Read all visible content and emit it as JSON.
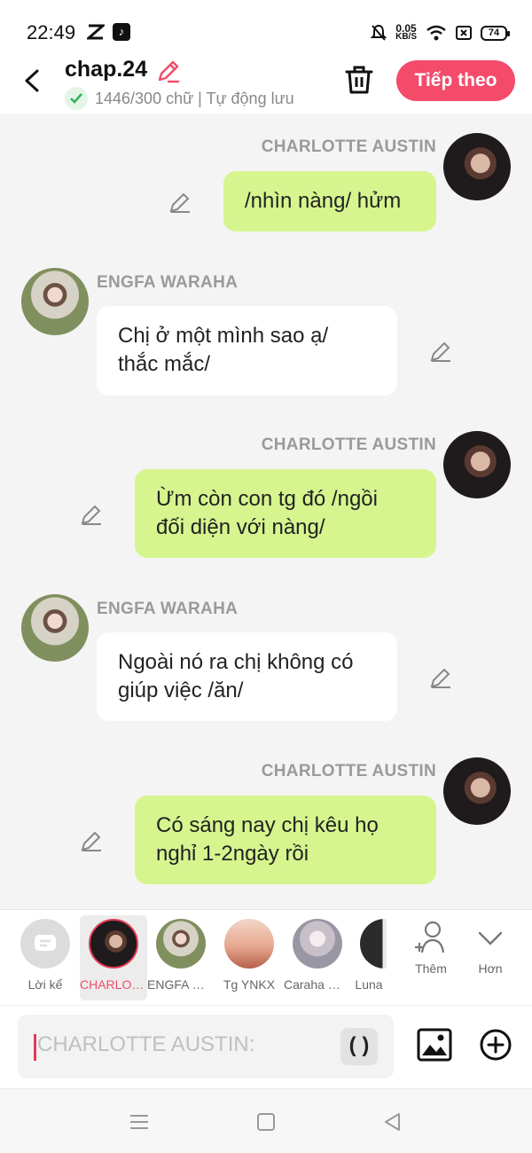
{
  "status_bar": {
    "time": "22:49",
    "speed_value": "0.05",
    "speed_unit": "KB/S",
    "battery": "74"
  },
  "header": {
    "title": "chap.24",
    "subtitle": "1446/300 chữ | Tự động lưu",
    "next_label": "Tiếp theo"
  },
  "messages": [
    {
      "side": "right",
      "name": "CHARLOTTE AUSTIN",
      "text": "/nhìn nàng/ hửm"
    },
    {
      "side": "left",
      "name": "ENGFA WARAHA",
      "text_line1": "Chị ở một mình sao ạ/",
      "text_line2": "thắc mắc/"
    },
    {
      "side": "right",
      "name": "CHARLOTTE AUSTIN",
      "text_line1": "Ừm còn con tg đó /ngồi",
      "text_line2": "đối diện với nàng/"
    },
    {
      "side": "left",
      "name": "ENGFA WARAHA",
      "text_line1": "Ngoài nó ra chị không có",
      "text_line2": "giúp việc /ăn/"
    },
    {
      "side": "right",
      "name": "CHARLOTTE AUSTIN",
      "text_line1": "Có sáng nay chị kêu họ",
      "text_line2": "nghỉ 1-2ngày  rồi"
    }
  ],
  "characters": [
    {
      "label": "Lời kể"
    },
    {
      "label": "CHARLOTTE AUSTIN",
      "selected": true
    },
    {
      "label": "ENGFA WARAHA"
    },
    {
      "label": "Tg YNKX"
    },
    {
      "label": "Caraha Wi..."
    },
    {
      "label": "Luna"
    }
  ],
  "char_actions": {
    "add_label": "Thêm",
    "more_label": "Hơn"
  },
  "input": {
    "placeholder": "CHARLOTTE AUSTIN:",
    "paren_label": "( )"
  },
  "colors": {
    "accent": "#f44b6a",
    "right_bubble": "#d6f58f",
    "left_bubble": "#ffffff"
  }
}
